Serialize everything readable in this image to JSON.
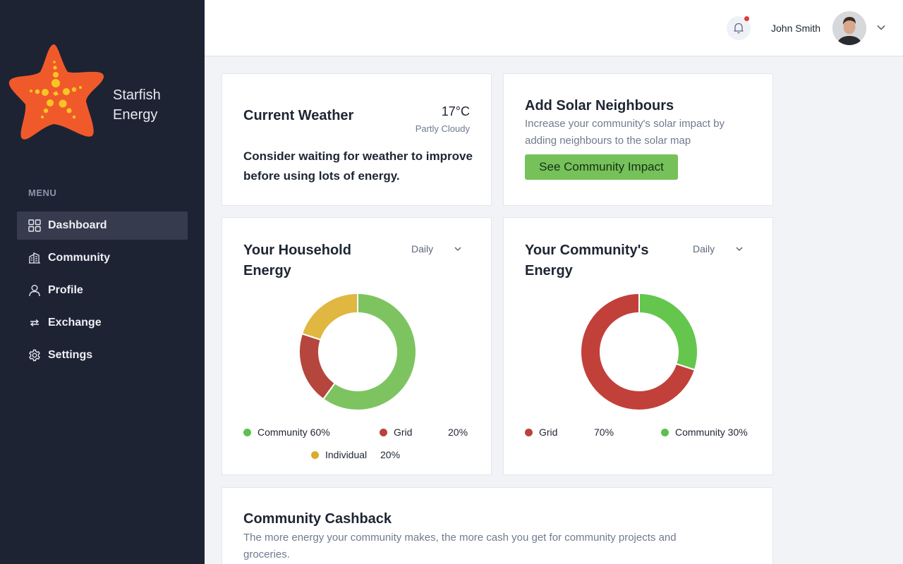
{
  "brand": {
    "line1": "Starfish",
    "line2": "Energy"
  },
  "menu": {
    "title": "MENU",
    "items": [
      {
        "label": "Dashboard",
        "icon": "grid-icon",
        "active": true
      },
      {
        "label": "Community",
        "icon": "buildings-icon"
      },
      {
        "label": "Profile",
        "icon": "user-icon"
      },
      {
        "label": "Exchange",
        "icon": "exchange-arrows-icon"
      },
      {
        "label": "Settings",
        "icon": "gear-icon"
      }
    ]
  },
  "header": {
    "user_name": "John Smith",
    "notification_dot_color": "#e23b3b"
  },
  "weather": {
    "title": "Current Weather",
    "temperature": "17°C",
    "condition": "Partly Cloudy",
    "advice": "Consider waiting for weather to improve before using lots of energy."
  },
  "solar": {
    "title": "Add Solar Neighbours",
    "description": "Increase your community's solar impact by adding neighbours to the solar map",
    "button_label": "See Community Impact"
  },
  "household": {
    "title": "Your Household Energy",
    "period": "Daily",
    "legend": [
      {
        "label": "Community 60%",
        "color": "#5cc04f"
      },
      {
        "label": "Grid",
        "value": "20%",
        "color": "#b7443c"
      },
      {
        "label": "Individual",
        "value": "20%",
        "color": "#d9ac2b"
      }
    ],
    "chart_data": {
      "type": "pie",
      "categories": [
        "Community",
        "Grid",
        "Individual"
      ],
      "values": [
        60,
        20,
        20
      ],
      "colors": [
        "#7dc461",
        "#b5463d",
        "#e0b741"
      ]
    }
  },
  "community": {
    "title": "Your Community's Energy",
    "period": "Daily",
    "legend": [
      {
        "label": "Grid",
        "value": "70%",
        "color": "#b7443c"
      },
      {
        "label": "Community 30%",
        "color": "#5cc04f"
      }
    ],
    "chart_data": {
      "type": "pie",
      "categories": [
        "Community",
        "Grid"
      ],
      "values": [
        30,
        70
      ],
      "colors": [
        "#65c64e",
        "#c2403a"
      ]
    }
  },
  "cashback": {
    "title": "Community Cashback",
    "description": "The more energy your community makes, the more cash you get for community projects and groceries."
  }
}
